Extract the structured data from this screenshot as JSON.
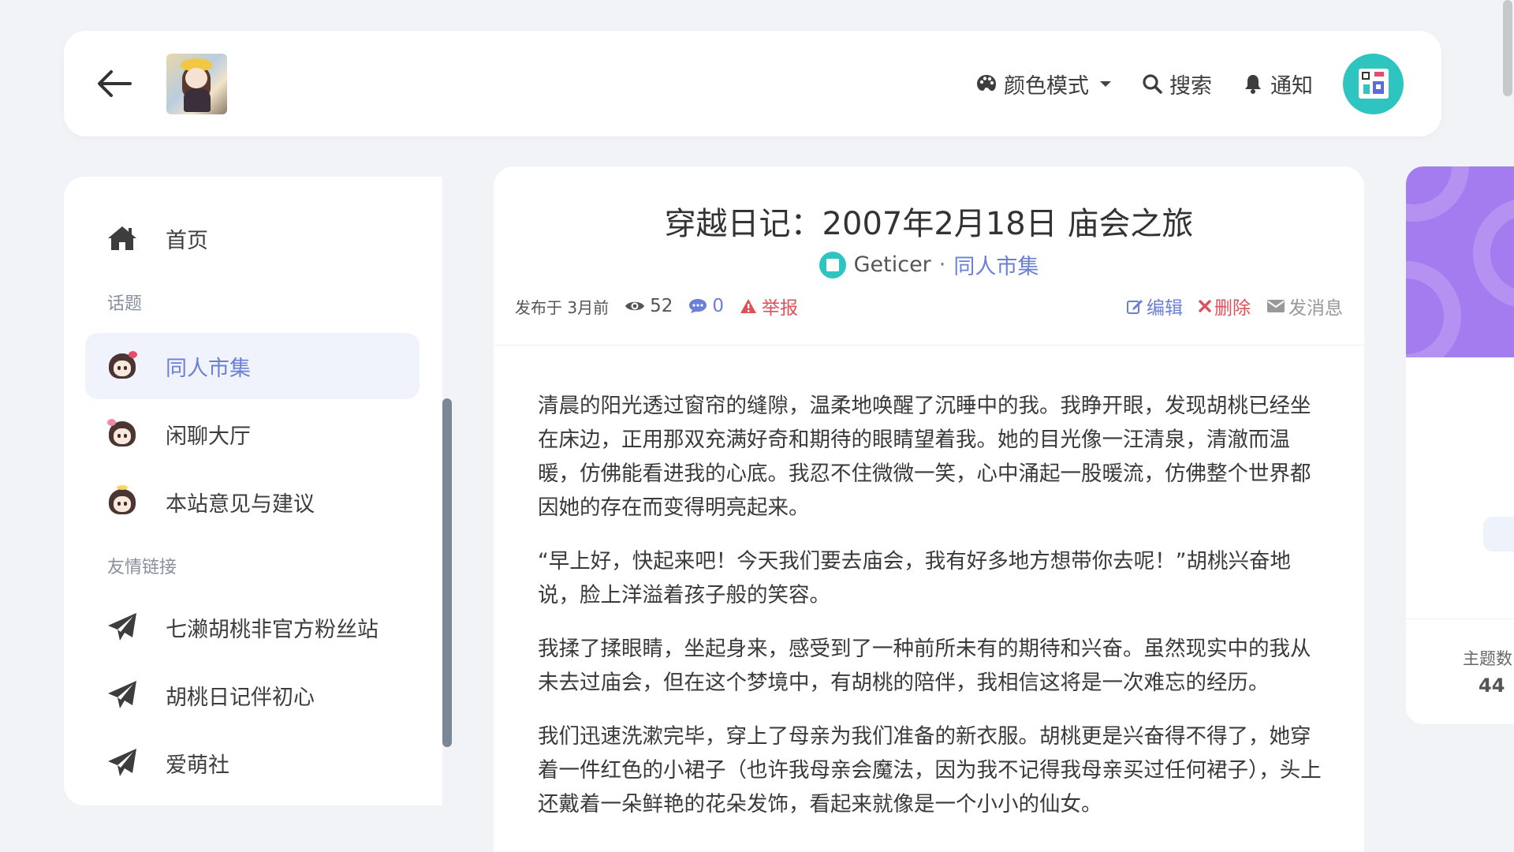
{
  "header": {
    "color_mode": "颜色模式",
    "search": "搜索",
    "notify": "通知"
  },
  "sidebar": {
    "home": "首页",
    "section_topics": "话题",
    "topics": [
      "同人市集",
      "闲聊大厅",
      "本站意见与建议"
    ],
    "section_links": "友情链接",
    "links": [
      "七濑胡桃非官方粉丝站",
      "胡桃日记伴初心",
      "爱萌社"
    ]
  },
  "article": {
    "title": "穿越日记：2007年2月18日 庙会之旅",
    "author": "Geticer",
    "separator": "·",
    "category": "同人市集",
    "published": "发布于 3月前",
    "views": "52",
    "comments": "0",
    "report": "举报",
    "edit": "编辑",
    "delete": "删除",
    "message": "发消息",
    "paragraphs": [
      "清晨的阳光透过窗帘的缝隙，温柔地唤醒了沉睡中的我。我睁开眼，发现胡桃已经坐在床边，正用那双充满好奇和期待的眼睛望着我。她的目光像一汪清泉，清澈而温暖，仿佛能看进我的心底。我忍不住微微一笑，心中涌起一股暖流，仿佛整个世界都因她的存在而变得明亮起来。",
      "“早上好，快起来吧！今天我们要去庙会，我有好多地方想带你去呢！”胡桃兴奋地说，脸上洋溢着孩子般的笑容。",
      "我揉了揉眼睛，坐起身来，感受到了一种前所未有的期待和兴奋。虽然现实中的我从未去过庙会，但在这个梦境中，有胡桃的陪伴，我相信这将是一次难忘的经历。",
      "我们迅速洗漱完毕，穿上了母亲为我们准备的新衣服。胡桃更是兴奋得不得了，她穿着一件红色的小裙子（也许我母亲会魔法，因为我不记得我母亲买过任何裙子），头上还戴着一朵鲜艳的花朵发饰，看起来就像是一个小小的仙女。"
    ]
  },
  "widget": {
    "label": "主题数",
    "value": "44"
  },
  "colors": {
    "accent": "#6b7fd6",
    "danger": "#e0505a",
    "avatar_bg": "#2ec4c0",
    "banner": "#a57bf0"
  },
  "icons": [
    "back-arrow-icon",
    "palette-icon",
    "search-icon",
    "bell-icon",
    "home-icon",
    "paper-plane-icon",
    "eye-icon",
    "comment-icon",
    "warning-icon",
    "edit-icon",
    "close-icon",
    "envelope-icon"
  ]
}
